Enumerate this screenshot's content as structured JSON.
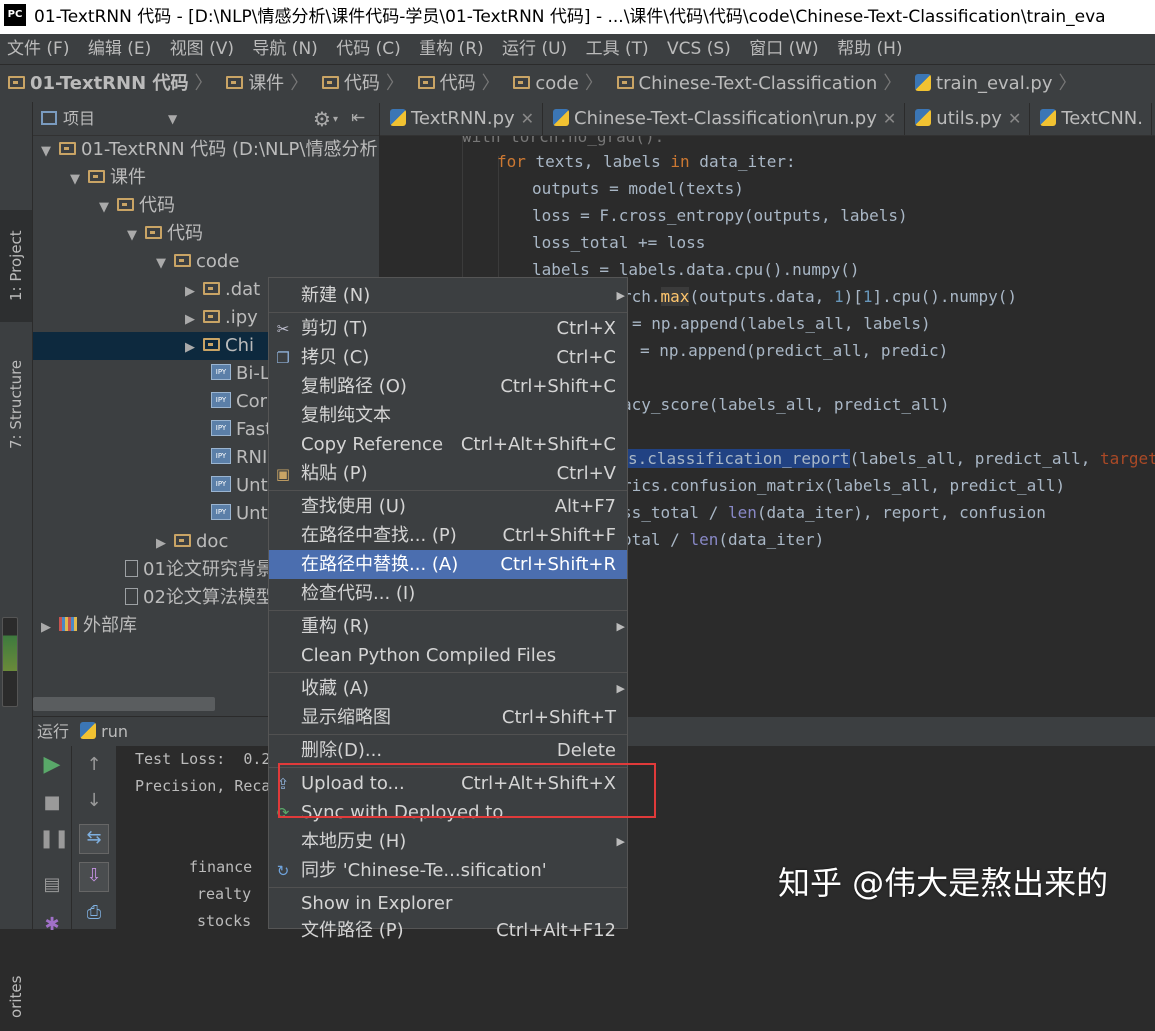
{
  "app": {
    "logo": "PC",
    "title": "01-TextRNN 代码 - [D:\\NLP\\情感分析\\课件代码-学员\\01-TextRNN 代码] - ...\\课件\\代码\\代码\\code\\Chinese-Text-Classification\\train_eva"
  },
  "menubar": [
    "文件 (F)",
    "编辑 (E)",
    "视图 (V)",
    "导航 (N)",
    "代码 (C)",
    "重构 (R)",
    "运行 (U)",
    "工具 (T)",
    "VCS (S)",
    "窗口 (W)",
    "帮助 (H)"
  ],
  "breadcrumbs": [
    "01-TextRNN 代码",
    "课件",
    "代码",
    "代码",
    "code",
    "Chinese-Text-Classification",
    "train_eval.py"
  ],
  "sidebar": {
    "project_tab": "1: Project",
    "structure_tab": "7: Structure",
    "favorites_tab": "orites"
  },
  "project": {
    "header": "项目",
    "tree": [
      {
        "label": "01-TextRNN 代码 (D:\\NLP\\情感分析",
        "level": 0,
        "icon": "folder",
        "expand": "open"
      },
      {
        "label": "课件",
        "level": 1,
        "icon": "folder",
        "expand": "open"
      },
      {
        "label": "代码",
        "level": 2,
        "icon": "folder",
        "expand": "open"
      },
      {
        "label": "代码",
        "level": 3,
        "icon": "folder",
        "expand": "open"
      },
      {
        "label": "code",
        "level": 4,
        "icon": "folder",
        "expand": "open"
      },
      {
        "label": ".dat",
        "level": 5,
        "icon": "folder",
        "expand": "closed"
      },
      {
        "label": ".ipy",
        "level": 5,
        "icon": "folder",
        "expand": "closed"
      },
      {
        "label": "Chi",
        "level": 5,
        "icon": "folder",
        "expand": "closed",
        "selected": true
      },
      {
        "label": "Bi-L",
        "level": 5,
        "icon": "ipynb",
        "expand": "none"
      },
      {
        "label": "Cor",
        "level": 5,
        "icon": "ipynb",
        "expand": "none"
      },
      {
        "label": "Fast",
        "level": 5,
        "icon": "ipynb",
        "expand": "none"
      },
      {
        "label": "RNI",
        "level": 5,
        "icon": "ipynb",
        "expand": "none"
      },
      {
        "label": "Unt",
        "level": 5,
        "icon": "ipynb",
        "expand": "none"
      },
      {
        "label": "Unt",
        "level": 5,
        "icon": "ipynb",
        "expand": "none"
      },
      {
        "label": "doc",
        "level": 4,
        "icon": "folder",
        "expand": "closed"
      },
      {
        "label": "01论文研究背景",
        "level": 3,
        "icon": "doc",
        "expand": "none"
      },
      {
        "label": "02论文算法模型",
        "level": 3,
        "icon": "doc",
        "expand": "none"
      },
      {
        "label": "外部库",
        "level": 0,
        "icon": "lib",
        "expand": "closed"
      }
    ]
  },
  "editor": {
    "tabs": [
      "TextRNN.py",
      "Chinese-Text-Classification\\run.py",
      "utils.py",
      "TextCNN."
    ],
    "code": {
      "l0": "with torch.no_grad():",
      "l1_kw1": "for",
      "l1_a": " texts, labels ",
      "l1_kw2": "in",
      "l1_b": " data_iter:",
      "l2": "outputs = model(texts)",
      "l3": "loss = F.cross_entropy(outputs, labels)",
      "l4": "loss_total += loss",
      "l5": "labels = labels.data.cpu().numpy()",
      "l6_a": "rch.",
      "l6_fn": "max",
      "l6_b": "(outputs.data, ",
      "l6_num": "1",
      "l6_c": ")[",
      "l6_num2": "1",
      "l6_d": "].cpu().numpy()",
      "l7": "= np.append(labels_all, labels)",
      "l8": "= np.append(predict_all, predic)",
      "l9": "acy_score(labels_all, predict_all)",
      "l10_hl": "s.classification_report",
      "l10_b": "(labels_all, predict_all, ",
      "l10_param": "target_nam",
      "l11": "rics.confusion_matrix(labels_all, predict_all)",
      "l12_a": "ss_total / ",
      "l12_fn": "len",
      "l12_b": "(data_iter), report, confusion",
      "l13_a": "otal / ",
      "l13_fn": "len",
      "l13_b": "(data_iter)"
    }
  },
  "run": {
    "label": "运行",
    "config": "run",
    "console": [
      "Test Loss:  0.2",
      "Precision, Reca",
      "",
      "",
      "finance",
      "realty",
      "stocks"
    ]
  },
  "context_menu": {
    "items": [
      {
        "label": "新建 (N)",
        "shortcut": "",
        "submenu": true
      },
      {
        "label": "剪切 (T)",
        "shortcut": "Ctrl+X",
        "icon": "scissors-icon"
      },
      {
        "label": "拷贝 (C)",
        "shortcut": "Ctrl+C",
        "icon": "copy-icon"
      },
      {
        "label": "复制路径 (O)",
        "shortcut": "Ctrl+Shift+C"
      },
      {
        "label": "复制纯文本",
        "shortcut": ""
      },
      {
        "label": "Copy Reference",
        "shortcut": "Ctrl+Alt+Shift+C"
      },
      {
        "label": "粘贴 (P)",
        "shortcut": "Ctrl+V",
        "icon": "paste-icon"
      },
      {
        "label": "查找使用 (U)",
        "shortcut": "Alt+F7"
      },
      {
        "label": "在路径中查找... (P)",
        "shortcut": "Ctrl+Shift+F"
      },
      {
        "label": "在路径中替换... (A)",
        "shortcut": "Ctrl+Shift+R",
        "active": true
      },
      {
        "label": "检查代码... (I)",
        "shortcut": ""
      },
      {
        "label": "重构 (R)",
        "shortcut": "",
        "submenu": true
      },
      {
        "label": "Clean Python Compiled Files",
        "shortcut": ""
      },
      {
        "label": "收藏 (A)",
        "shortcut": "",
        "submenu": true
      },
      {
        "label": "显示缩略图",
        "shortcut": "Ctrl+Shift+T"
      },
      {
        "label": "删除(D)...",
        "shortcut": "Delete"
      },
      {
        "label": "Upload to...",
        "shortcut": "Ctrl+Alt+Shift+X",
        "icon": "upload-icon"
      },
      {
        "label": "Sync with Deployed to",
        "shortcut": "",
        "icon": "sync-icon"
      },
      {
        "label": "本地历史 (H)",
        "shortcut": "",
        "submenu": true
      },
      {
        "label": "同步 'Chinese-Te...sification'",
        "shortcut": "",
        "icon": "refresh-icon"
      },
      {
        "label": "Show in Explorer",
        "shortcut": ""
      },
      {
        "label": "文件路径 (P)",
        "shortcut": "Ctrl+Alt+F12"
      }
    ]
  },
  "watermark": "知乎 @伟大是熬出来的",
  "colors": {
    "menu_active": "#4b6eaf",
    "annotation_box": "#e03a3a",
    "selection": "#214283"
  }
}
